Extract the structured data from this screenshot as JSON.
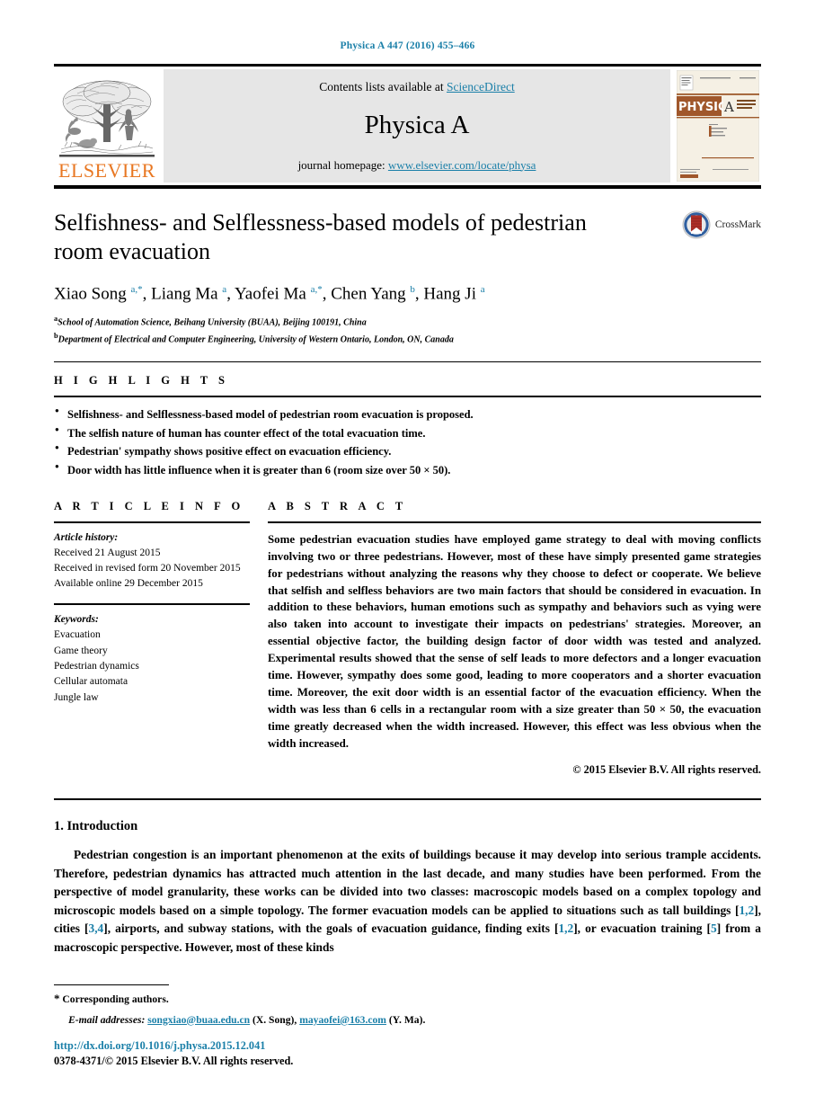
{
  "running_head": "Physica A 447 (2016) 455–466",
  "masthead": {
    "publisher_logo_text": "ELSEVIER",
    "contents_prefix": "Contents lists available at ",
    "contents_link": "ScienceDirect",
    "journal_name": "Physica A",
    "homepage_prefix": "journal homepage: ",
    "homepage_link": "www.elsevier.com/locate/physa",
    "cover": {
      "journal_word": "PHYSICA",
      "journal_letter": "A",
      "subtitle": "STATISTICAL MECHANICS AND ITS APPLICATIONS"
    }
  },
  "article": {
    "title": "Selfishness- and Selflessness-based models of pedestrian room evacuation",
    "crossmark_label": "CrossMark",
    "authors_html": "Xiao Song <sup>a,*</sup>, Liang Ma <sup>a</sup>, Yaofei Ma <sup>a,*</sup>, Chen Yang <sup>b</sup>, Hang Ji <sup>a</sup>",
    "affiliations": [
      {
        "marker": "a",
        "text": "School of Automation Science, Beihang University (BUAA), Beijing 100191, China"
      },
      {
        "marker": "b",
        "text": "Department of Electrical and Computer Engineering, University of Western Ontario, London, ON, Canada"
      }
    ]
  },
  "highlights": {
    "label": "H I G H L I G H T S",
    "items": [
      "Selfishness- and Selflessness-based model of pedestrian room evacuation is proposed.",
      "The selfish nature of human has counter effect of the total evacuation time.",
      "Pedestrian' sympathy shows positive effect on evacuation efficiency.",
      "Door width has little influence when it is greater than 6 (room size over 50 × 50)."
    ]
  },
  "article_info": {
    "label": "A R T I C L E   I N F O",
    "history_title": "Article history:",
    "history_lines": [
      "Received 21 August 2015",
      "Received in revised form 20 November 2015",
      "Available online 29 December 2015"
    ],
    "keywords_title": "Keywords:",
    "keywords": [
      "Evacuation",
      "Game theory",
      "Pedestrian dynamics",
      "Cellular automata",
      "Jungle law"
    ]
  },
  "abstract": {
    "label": "A B S T R A C T",
    "text": "Some pedestrian evacuation studies have employed game strategy to deal with moving conflicts involving two or three pedestrians. However, most of these have simply presented game strategies for pedestrians without analyzing the reasons why they choose to defect or cooperate. We believe that selfish and selfless behaviors are two main factors that should be considered in evacuation. In addition to these behaviors, human emotions such as sympathy and behaviors such as vying were also taken into account to investigate their impacts on pedestrians' strategies. Moreover, an essential objective factor, the building design factor of door width was tested and analyzed. Experimental results showed that the sense of self leads to more defectors and a longer evacuation time. However, sympathy does some good, leading to more cooperators and a shorter evacuation time. Moreover, the exit door width is an essential factor of the evacuation efficiency. When the width was less than 6 cells in a rectangular room with a size greater than 50 × 50, the evacuation time greatly decreased when the width increased. However, this effect was less obvious when the width increased.",
    "copyright": "© 2015 Elsevier B.V. All rights reserved."
  },
  "body": {
    "section_number_title": "1. Introduction",
    "paragraph_1_html": "Pedestrian congestion is an important phenomenon at the exits of buildings because it may develop into serious trample accidents. Therefore, pedestrian dynamics has attracted much attention in the last decade, and many studies have been performed. From the perspective of model granularity, these works can be divided into two classes: macroscopic models based on a complex topology and microscopic models based on a simple topology. The former evacuation models can be applied to situations such as tall buildings [<span class=\"ref\">1,2</span>], cities [<span class=\"ref\">3,4</span>], airports, and subway stations, with the goals of evacuation guidance, finding exits [<span class=\"ref\">1,2</span>], or evacuation training [<span class=\"ref\">5</span>] from a macroscopic perspective. However, most of these kinds"
  },
  "footer": {
    "corresponding_star": "*",
    "corresponding_text": "Corresponding authors.",
    "email_label": "E-mail addresses:",
    "email_1": "songxiao@buaa.edu.cn",
    "email_1_who": "(X. Song),",
    "email_2": "mayaofei@163.com",
    "email_2_who": "(Y. Ma).",
    "doi": "http://dx.doi.org/10.1016/j.physa.2015.12.041",
    "issn": "0378-4371/© 2015 Elsevier B.V. All rights reserved."
  },
  "colors": {
    "link": "#1a7fa8",
    "elsevier_orange": "#E87722",
    "masthead_bg": "#e6e6e6",
    "crossmark_red": "#b03028"
  }
}
